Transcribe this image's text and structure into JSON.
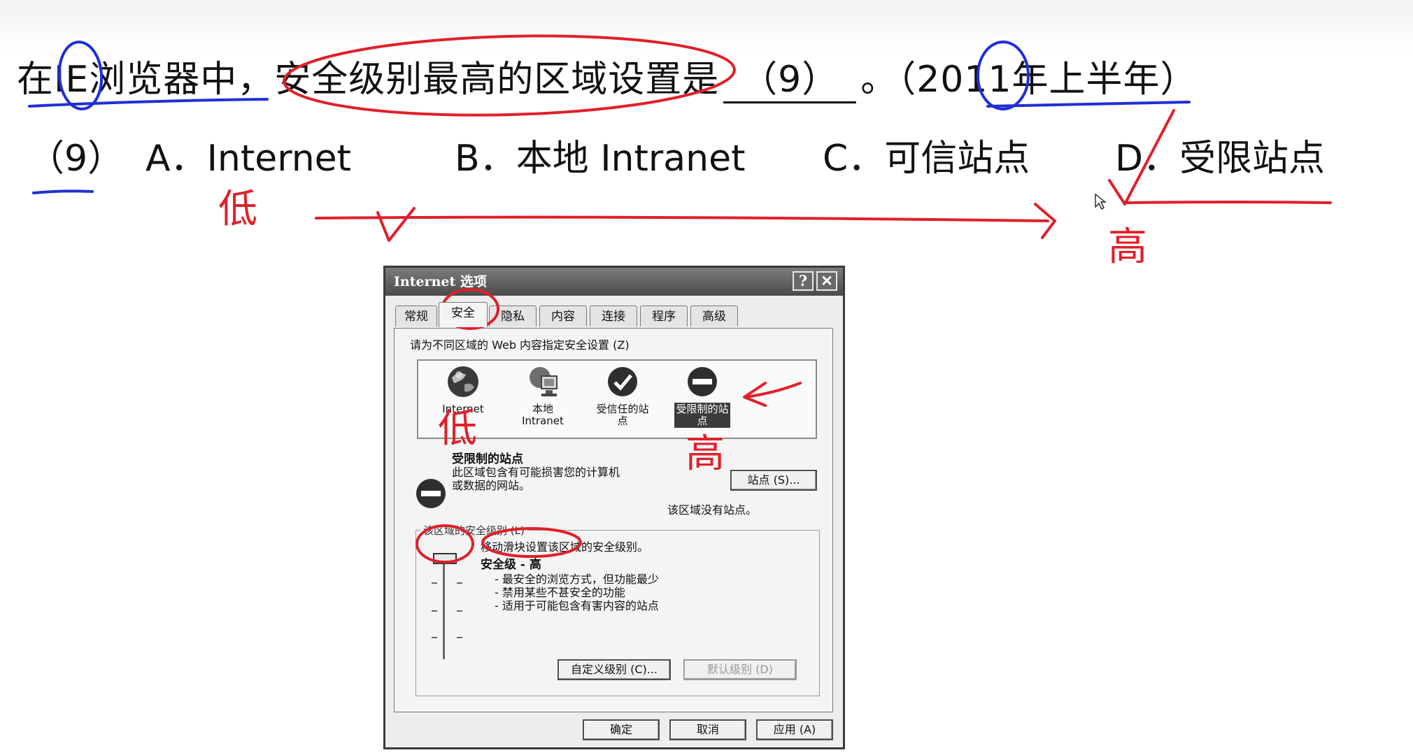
{
  "question": {
    "prefix": "在IE浏览器中，安全级别最高的区域设置是",
    "blank": "（9）",
    "suffix": "。（2011年上半年）"
  },
  "options": {
    "number": "（9）",
    "a": "A．Internet",
    "b": "B．本地 Intranet",
    "c": "C．可信站点",
    "d": "D．受限站点"
  },
  "annotations": {
    "low": "低",
    "high": "高"
  },
  "dialog": {
    "title": "Internet 选项",
    "help_btn": "?",
    "close_btn": "✕",
    "tabs": [
      "常规",
      "安全",
      "隐私",
      "内容",
      "连接",
      "程序",
      "高级"
    ],
    "active_tab": "安全",
    "instruction": "请为不同区域的 Web 内容指定安全设置 (Z)",
    "zones": [
      {
        "line1": "Internet",
        "line2": ""
      },
      {
        "line1": "本地",
        "line2": "Intranet"
      },
      {
        "line1": "受信任的站",
        "line2": "点"
      },
      {
        "line1": "受限制的站",
        "line2": "点"
      }
    ],
    "selected_zone": {
      "title": "受限制的站点",
      "desc1": "此区域包含有可能损害您的计算机",
      "desc2": "或数据的网站。",
      "sites_button": "站点 (S)...",
      "no_sites": "该区域没有站点。"
    },
    "security_level": {
      "group_title": "该区域的安全级别 (L)",
      "slider_hint": "移动滑块设置该区域的安全级别。",
      "level": "安全级 - 高",
      "bullets": [
        "- 最安全的浏览方式，但功能最少",
        "- 禁用某些不甚安全的功能",
        "- 适用于可能包含有害内容的站点"
      ],
      "level_fraction": 1.0
    },
    "custom_button": "自定义级别 (C)...",
    "default_button": "默认级别 (D)",
    "ok_button": "确定",
    "cancel_button": "取消",
    "apply_button": "应用 (A)"
  },
  "colors": {
    "red_ink": "#e0202a",
    "blue_ink": "#1f2fd6"
  }
}
